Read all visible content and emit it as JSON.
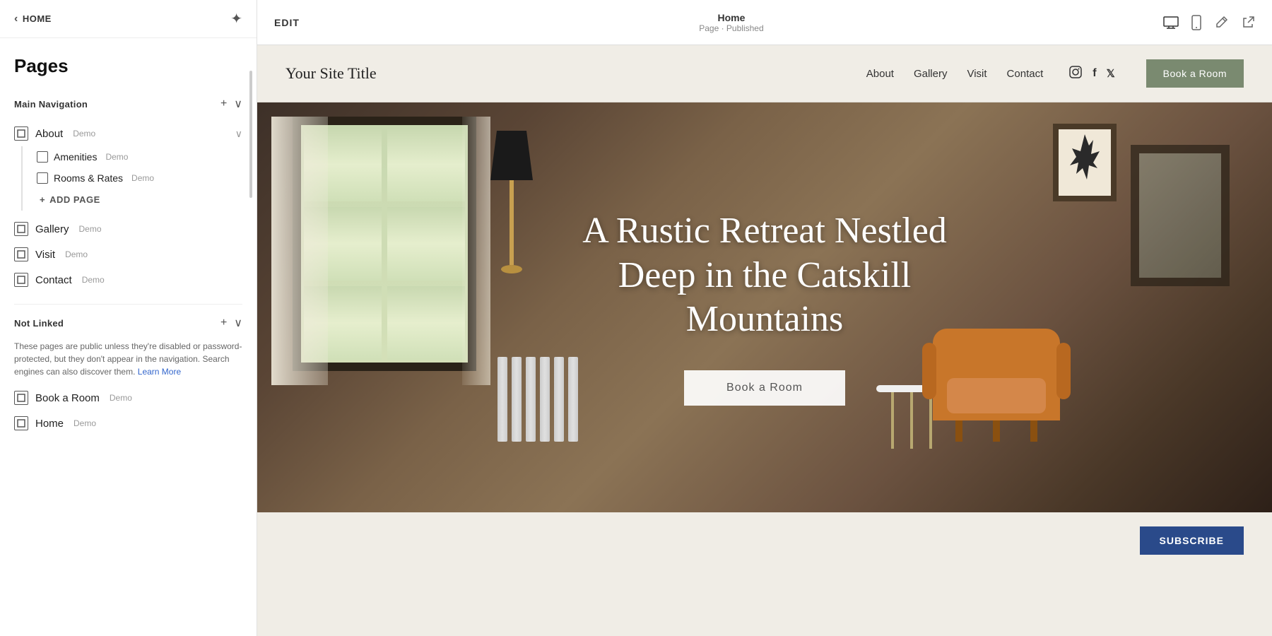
{
  "sidebar": {
    "back_label": "HOME",
    "title": "Pages",
    "main_navigation": {
      "label": "Main Navigation",
      "pages": [
        {
          "name": "About",
          "badge": "Demo",
          "has_children": true,
          "children": [
            {
              "name": "Amenities",
              "badge": "Demo"
            },
            {
              "name": "Rooms & Rates",
              "badge": "Demo"
            }
          ]
        },
        {
          "name": "Gallery",
          "badge": "Demo",
          "has_children": false
        },
        {
          "name": "Visit",
          "badge": "Demo",
          "has_children": false
        },
        {
          "name": "Contact",
          "badge": "Demo",
          "has_children": false
        }
      ],
      "add_page_label": "ADD PAGE"
    },
    "not_linked": {
      "label": "Not Linked",
      "description": "These pages are public unless they're disabled or password-protected, but they don't appear in the navigation. Search engines can also discover them.",
      "learn_more": "Learn More",
      "pages": [
        {
          "name": "Book a Room",
          "badge": "Demo"
        },
        {
          "name": "Home",
          "badge": "Demo"
        }
      ]
    }
  },
  "topbar": {
    "edit_label": "EDIT",
    "page_title": "Home",
    "page_subtitle": "Page · Published"
  },
  "site": {
    "logo": "Your Site Title",
    "nav_items": [
      "About",
      "Gallery",
      "Visit",
      "Contact"
    ],
    "book_button": "Book a Room",
    "hero_heading": "A Rustic Retreat Nestled Deep in the Catskill Mountains",
    "hero_cta": "Book a Room",
    "subscribe_button": "SUBSCRIBE"
  },
  "icons": {
    "back_arrow": "‹",
    "sparkle": "✦",
    "plus": "+",
    "chevron_down": "∨",
    "desktop": "🖥",
    "mobile": "📱",
    "edit_pen": "✏",
    "external_link": "↗",
    "instagram": "Instagram",
    "facebook": "f",
    "twitter": "𝕏"
  }
}
